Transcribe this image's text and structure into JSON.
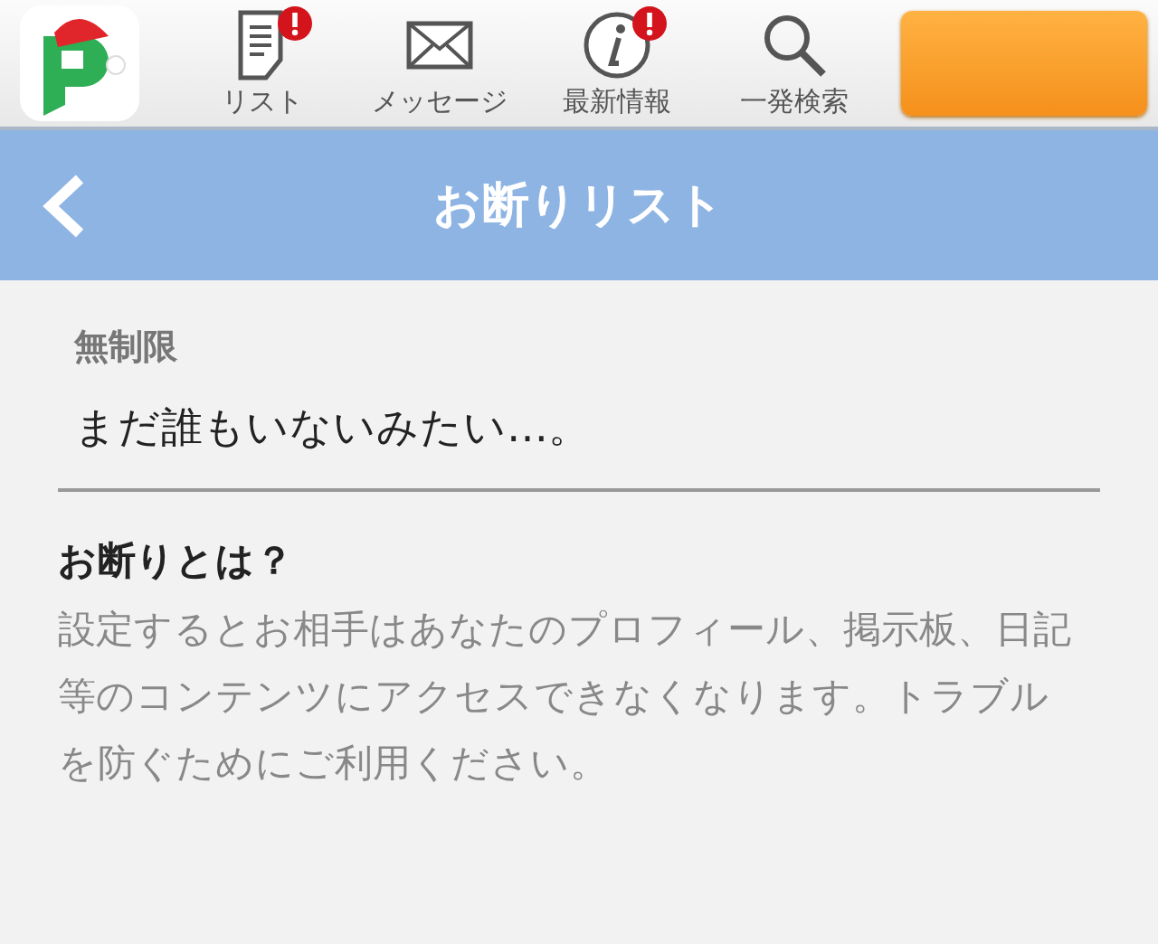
{
  "nav": [
    {
      "kind": "list",
      "label": "リスト",
      "alert": true
    },
    {
      "kind": "mail",
      "label": "メッセージ",
      "alert": false
    },
    {
      "kind": "info",
      "label": "最新情報",
      "alert": true
    },
    {
      "kind": "search",
      "label": "一発検索",
      "alert": false
    }
  ],
  "title_bar": {
    "title": "お断りリスト"
  },
  "section": {
    "label": "無制限",
    "empty_text": "まだ誰もいないみたい…。"
  },
  "help": {
    "heading": "お断りとは？",
    "body": "設定するとお相手はあなたのプロフィール、掲示板、日記等のコンテンツにアクセスできなくなります。トラブルを防ぐためにご利用ください。"
  }
}
